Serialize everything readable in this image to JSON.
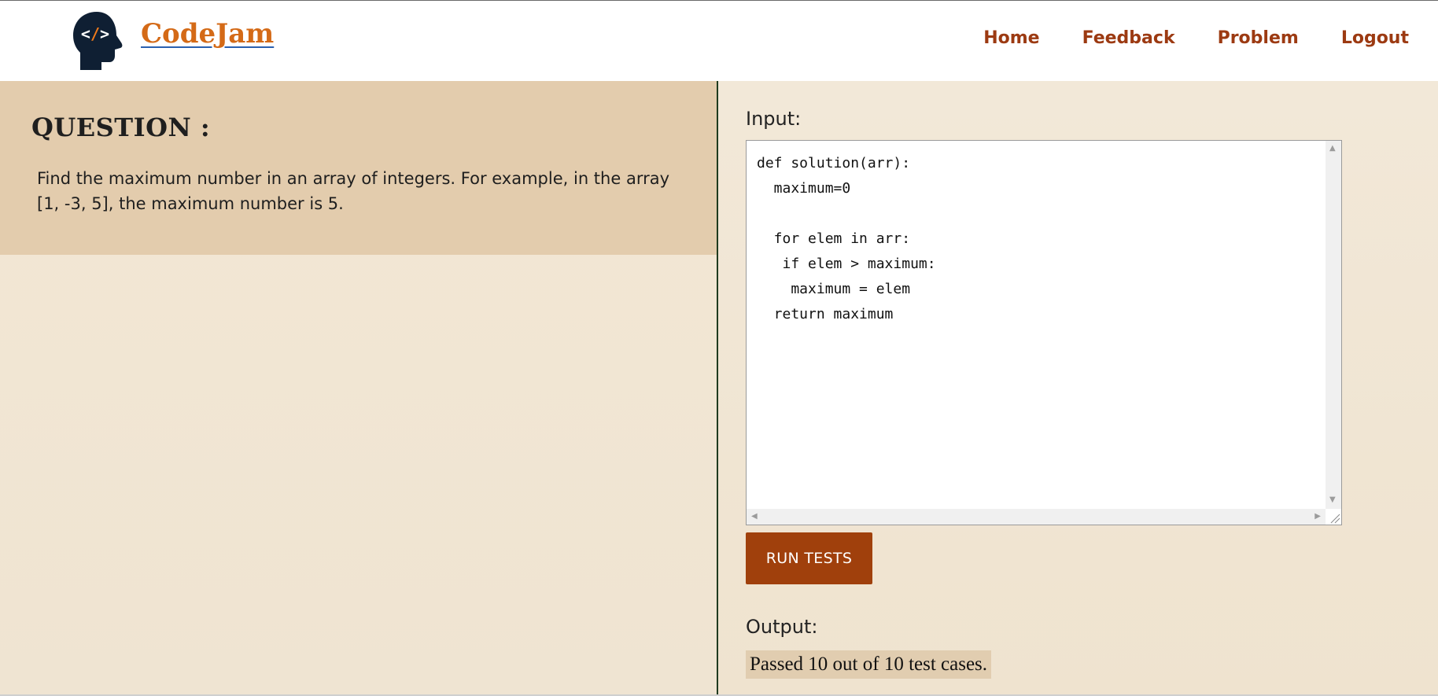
{
  "app": {
    "brand": "CodeJam",
    "logo_icon": "code-head-icon"
  },
  "nav": {
    "items": [
      "Home",
      "Feedback",
      "Problem",
      "Logout"
    ]
  },
  "question": {
    "title": "QUESTION :",
    "text": "Find the maximum number in an array of integers. For example, in the array [1, -3, 5], the maximum number is 5."
  },
  "editor": {
    "label": "Input:",
    "code": "def solution(arr):\n  maximum=0\n\n  for elem in arr:\n   if elem > maximum:\n    maximum = elem\n  return maximum"
  },
  "run": {
    "label": "RUN TESTS"
  },
  "output": {
    "label": "Output:",
    "result": "Passed 10 out of 10 test cases."
  },
  "colors": {
    "brand": "#d46a17",
    "nav": "#9c3a12",
    "button": "#a0400c",
    "question_bg": "#e3ccad",
    "output_bg": "#e1cdb0"
  }
}
